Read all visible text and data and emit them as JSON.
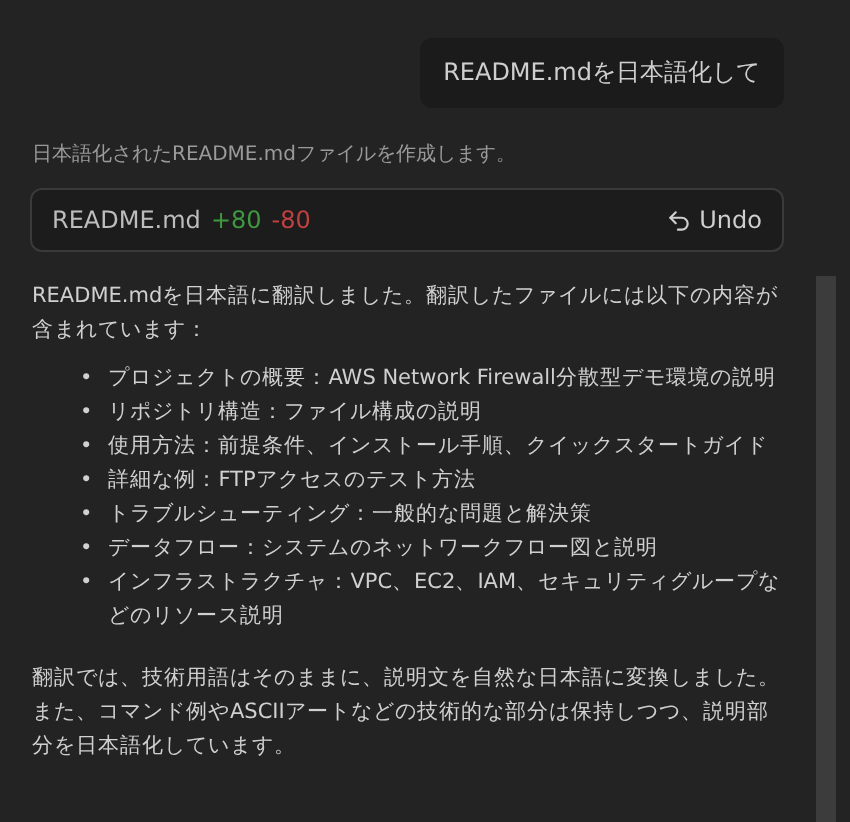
{
  "user_message": "README.mdを日本語化して",
  "status": "日本語化されたREADME.mdファイルを作成します。",
  "file_change": {
    "filename": "README.md",
    "added": "+80",
    "removed": "-80",
    "undo_label": "Undo"
  },
  "response": {
    "intro": "README.mdを日本語に翻訳しました。翻訳したファイルには以下の内容が含まれています：",
    "bullet": "•",
    "items": [
      "プロジェクトの概要：AWS Network Firewall分散型デモ環境の説明",
      "リポジトリ構造：ファイル構成の説明",
      "使用方法：前提条件、インストール手順、クイックスタートガイド",
      "詳細な例：FTPアクセスのテスト方法",
      "トラブルシューティング：一般的な問題と解決策",
      "データフロー：システムのネットワークフロー図と説明",
      "インフラストラクチャ：VPC、EC2、IAM、セキュリティグループなどのリソース説明"
    ],
    "outro": "翻訳では、技術用語はそのままに、説明文を自然な日本語に変換しました。また、コマンド例やASCIIアートなどの技術的な部分は保持しつつ、説明部分を日本語化しています。"
  }
}
